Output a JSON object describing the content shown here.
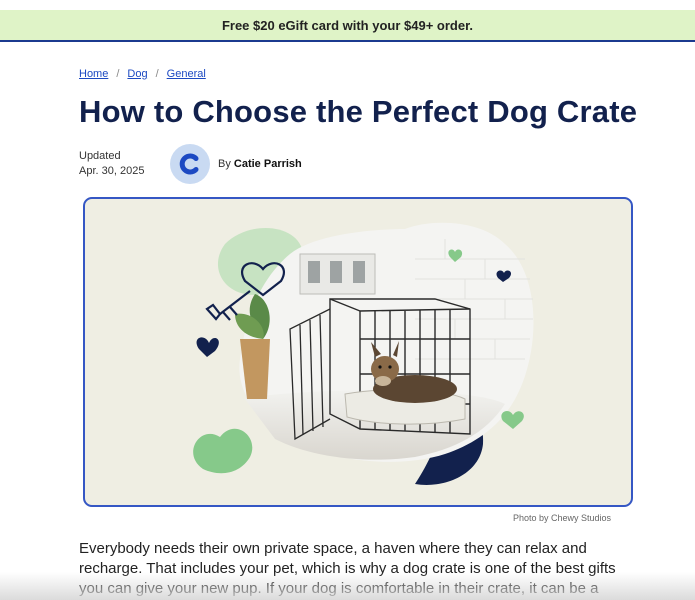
{
  "promo": {
    "text": "Free $20 eGift card with your $49+ order."
  },
  "breadcrumb": {
    "items": [
      "Home",
      "Dog",
      "General"
    ],
    "separator": "/"
  },
  "article": {
    "title": "How to Choose the Perfect Dog Crate",
    "updated_label": "Updated",
    "updated_date": "Apr. 30, 2025",
    "by_label": "By",
    "author": "Catie Parrish",
    "photo_credit": "Photo by Chewy Studios",
    "intro": "Everybody needs their own private space, a haven where they can relax and recharge. That includes your pet, which is why a dog crate is one of the best gifts you can give your new pup. If your dog is comfortable in their crate, it can be a"
  },
  "colors": {
    "promo_bg": "#dff3c7",
    "title": "#12214d",
    "link": "#1c49c2",
    "accent_green": "#86c98a",
    "accent_navy": "#12214d"
  },
  "icons": {
    "author_avatar": "chewy-logo-icon",
    "hero_decor": [
      "key-heart-icon",
      "heart-icon"
    ]
  }
}
